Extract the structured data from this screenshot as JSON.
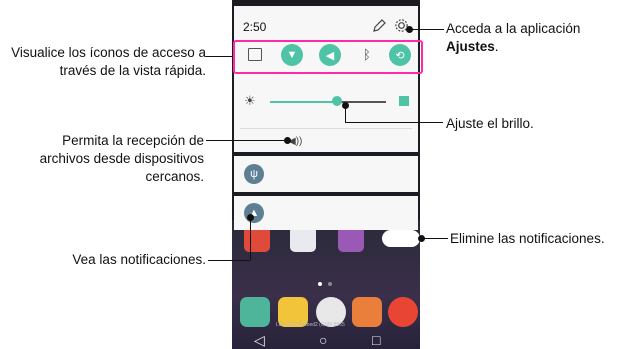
{
  "status": {
    "time": "2:50"
  },
  "quick_settings": {
    "icons": [
      "capture-icon",
      "wifi-icon",
      "sound-icon",
      "bluetooth-icon",
      "rotation-icon"
    ]
  },
  "brightness": {
    "level": 0.58
  },
  "bottom_bar": {
    "carrier_text": "LGE LTE Testbed2 (GSM 8965"
  },
  "callouts": {
    "quick_access": "Visualice los íconos de acceso a través de la vista rápida.",
    "settings_prefix": "Acceda a la aplicación",
    "settings_bold": "Ajustes",
    "settings_suffix": ".",
    "brightness": "Ajuste el brillo.",
    "nearby_files": "Permita la recepción de archivos desde dispositivos cercanos.",
    "notifications_view": "Vea las notificaciones.",
    "notifications_clear": "Elimine las notificaciones."
  },
  "colors": {
    "accent": "#4fc3a6",
    "highlight": "#ff2aa8"
  }
}
